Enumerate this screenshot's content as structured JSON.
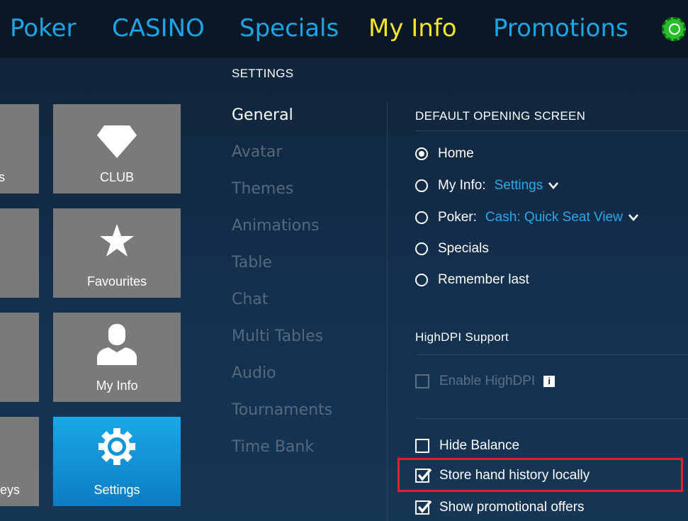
{
  "nav": {
    "items": [
      "Poker",
      "CASINO",
      "Specials",
      "My Info",
      "Promotions"
    ],
    "active": "My Info"
  },
  "tiles": {
    "left_partial": [
      "s",
      "",
      "",
      "eys"
    ],
    "main": [
      "CLUB",
      "Favourites",
      "My Info",
      "Settings"
    ],
    "selected": "Settings"
  },
  "settings": {
    "heading": "SETTINGS",
    "menu": [
      "General",
      "Avatar",
      "Themes",
      "Animations",
      "Table",
      "Chat",
      "Multi Tables",
      "Audio",
      "Tournaments",
      "Time Bank"
    ],
    "active_menu": "General"
  },
  "default_screen": {
    "heading": "DEFAULT OPENING SCREEN",
    "home": "Home",
    "myinfo_label": "My Info:",
    "myinfo_value": "Settings",
    "poker_label": "Poker:",
    "poker_value": "Cash: Quick Seat View",
    "specials": "Specials",
    "remember_last": "Remember last",
    "selected": "Home"
  },
  "highdpi": {
    "heading": "HighDPI Support",
    "enable": "Enable HighDPI",
    "info_glyph": "i"
  },
  "options": {
    "hide_balance": "Hide Balance",
    "store_hand_history": "Store hand history locally",
    "show_promotional": "Show promotional offers"
  },
  "colors": {
    "accent": "#1aa6e6",
    "active_nav": "#f6e52a",
    "tile_grey": "#7a7a7a",
    "tile_selected": "#1aa8e8",
    "highlight": "#e0202a"
  }
}
